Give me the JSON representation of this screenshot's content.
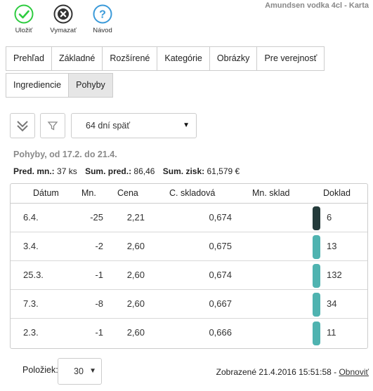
{
  "window": {
    "title": "Amundsen vodka 4cl - Karta"
  },
  "toolbar": {
    "save": {
      "label": "Uložiť",
      "icon": "check-circle-icon",
      "color": "#2ecc40"
    },
    "delete": {
      "label": "Vymazať",
      "icon": "x-circle-icon",
      "color": "#333333"
    },
    "help": {
      "label": "Návod",
      "icon": "question-circle-icon",
      "color": "#3a9ad9"
    }
  },
  "tabs": {
    "row1": [
      "Prehľad",
      "Základné",
      "Rozšírené",
      "Kategórie",
      "Obrázky",
      "Pre verejnosť"
    ],
    "row2": [
      "Ingrediencie",
      "Pohyby"
    ],
    "active": "Pohyby"
  },
  "filter": {
    "collapse_icon": "double-chevron-down-icon",
    "filter_icon": "funnel-icon",
    "period_select": "64 dní späť"
  },
  "period_title": "Pohyby, od 17.2. do 21.4.",
  "summary": {
    "qty_label": "Pred. mn.:",
    "qty_value": "37 ks",
    "sales_label": "Sum. pred.:",
    "sales_value": "86,46",
    "profit_label": "Sum. zisk:",
    "profit_value": "61,579 €"
  },
  "grid": {
    "headers": {
      "date": "Dátum",
      "qty": "Mn.",
      "price": "Cena",
      "stock_price": "C. skladová",
      "stock_qty": "Mn. sklad",
      "document": "Doklad"
    },
    "rows": [
      {
        "date": "6.4.",
        "qty": "-25",
        "price": "2,21",
        "stock_price": "0,674",
        "stock_qty": "",
        "document": "6",
        "color": "#243b3b"
      },
      {
        "date": "3.4.",
        "qty": "-2",
        "price": "2,60",
        "stock_price": "0,675",
        "stock_qty": "",
        "document": "13",
        "color": "#4fb3b0"
      },
      {
        "date": "25.3.",
        "qty": "-1",
        "price": "2,60",
        "stock_price": "0,674",
        "stock_qty": "",
        "document": "132",
        "color": "#4fb3b0"
      },
      {
        "date": "7.3.",
        "qty": "-8",
        "price": "2,60",
        "stock_price": "0,667",
        "stock_qty": "",
        "document": "34",
        "color": "#4fb3b0"
      },
      {
        "date": "2.3.",
        "qty": "-1",
        "price": "2,60",
        "stock_price": "0,666",
        "stock_qty": "",
        "document": "11",
        "color": "#4fb3b0"
      }
    ]
  },
  "footer": {
    "page_size_label": "Položiek:",
    "page_size": "30",
    "shown_text": "Zobrazené 21.4.2016 15:51:58 -",
    "refresh_label": "Obnoviť"
  }
}
